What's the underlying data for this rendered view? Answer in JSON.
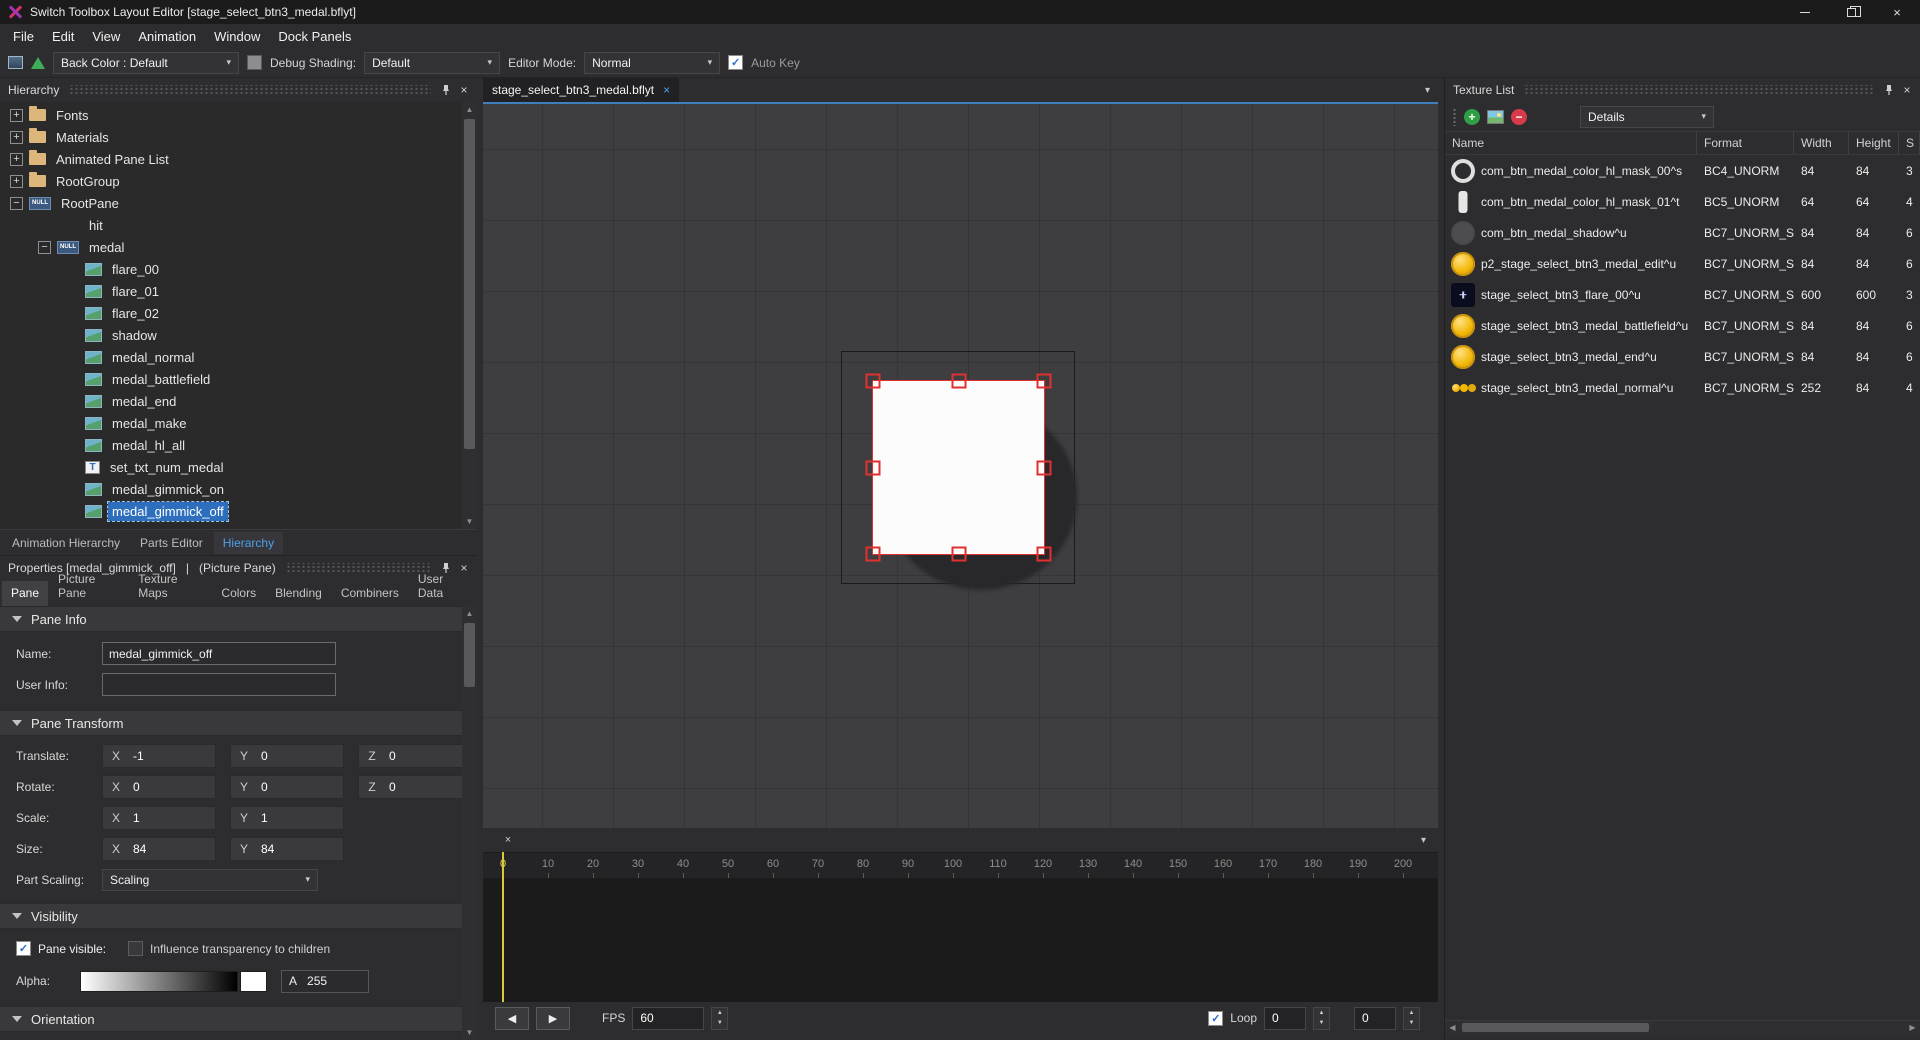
{
  "window": {
    "title": "Switch Toolbox Layout Editor [stage_select_btn3_medal.bflyt]"
  },
  "menu": {
    "items": [
      "File",
      "Edit",
      "View",
      "Animation",
      "Window",
      "Dock Panels"
    ]
  },
  "toolbar": {
    "back_color": "Back Color : Default",
    "debug_shading_label": "Debug Shading:",
    "debug_shading_value": "Default",
    "editor_mode_label": "Editor Mode:",
    "editor_mode_value": "Normal",
    "auto_key": "Auto Key",
    "auto_key_checked": true
  },
  "hierarchy": {
    "title": "Hierarchy",
    "items": [
      {
        "depth": 0,
        "expander": "+",
        "icon": "folder",
        "label": "Fonts"
      },
      {
        "depth": 0,
        "expander": "+",
        "icon": "folder",
        "label": "Materials"
      },
      {
        "depth": 0,
        "expander": "+",
        "icon": "folder",
        "label": "Animated Pane List"
      },
      {
        "depth": 0,
        "expander": "+",
        "icon": "folder",
        "label": "RootGroup"
      },
      {
        "depth": 0,
        "expander": "-",
        "icon": "null",
        "label": "RootPane"
      },
      {
        "depth": 2,
        "expander": "",
        "icon": "",
        "label": "hit"
      },
      {
        "depth": 1,
        "expander": "-",
        "icon": "null",
        "label": "medal"
      },
      {
        "depth": 2,
        "expander": "",
        "icon": "picture",
        "label": "flare_00"
      },
      {
        "depth": 2,
        "expander": "",
        "icon": "picture",
        "label": "flare_01"
      },
      {
        "depth": 2,
        "expander": "",
        "icon": "picture",
        "label": "flare_02"
      },
      {
        "depth": 2,
        "expander": "",
        "icon": "picture",
        "label": "shadow"
      },
      {
        "depth": 2,
        "expander": "",
        "icon": "picture",
        "label": "medal_normal"
      },
      {
        "depth": 2,
        "expander": "",
        "icon": "picture",
        "label": "medal_battlefield"
      },
      {
        "depth": 2,
        "expander": "",
        "icon": "picture",
        "label": "medal_end"
      },
      {
        "depth": 2,
        "expander": "",
        "icon": "picture",
        "label": "medal_make"
      },
      {
        "depth": 2,
        "expander": "",
        "icon": "picture",
        "label": "medal_hl_all"
      },
      {
        "depth": 2,
        "expander": "",
        "icon": "text",
        "label": "set_txt_num_medal"
      },
      {
        "depth": 2,
        "expander": "",
        "icon": "picture",
        "label": "medal_gimmick_on"
      },
      {
        "depth": 2,
        "expander": "",
        "icon": "picture",
        "label": "medal_gimmick_off",
        "selected": true
      }
    ],
    "tabs": [
      {
        "label": "Animation Hierarchy",
        "active": false
      },
      {
        "label": "Parts Editor",
        "active": false
      },
      {
        "label": "Hierarchy",
        "active": true
      }
    ]
  },
  "properties": {
    "title": "Properties [medal_gimmick_off]",
    "separator": "|",
    "subtitle": "(Picture Pane)",
    "tabs": [
      "Pane",
      "Picture Pane",
      "Texture Maps",
      "Colors",
      "Blending",
      "Combiners",
      "User Data"
    ],
    "active_tab": "Pane",
    "pane_info": {
      "section": "Pane Info",
      "name_label": "Name:",
      "name_value": "medal_gimmick_off",
      "user_info_label": "User Info:",
      "user_info_value": ""
    },
    "transform": {
      "section": "Pane Transform",
      "axis": {
        "x": "X",
        "y": "Y",
        "z": "Z"
      },
      "translate_label": "Translate:",
      "translate": {
        "x": "-1",
        "y": "0",
        "z": "0"
      },
      "rotate_label": "Rotate:",
      "rotate": {
        "x": "0",
        "y": "0",
        "z": "0"
      },
      "scale_label": "Scale:",
      "scale": {
        "x": "1",
        "y": "1"
      },
      "size_label": "Size:",
      "size": {
        "x": "84",
        "y": "84"
      },
      "part_scaling_label": "Part Scaling:",
      "part_scaling_value": "Scaling"
    },
    "visibility": {
      "section": "Visibility",
      "pane_visible_label": "Pane visible:",
      "pane_visible_checked": true,
      "influence_label": "Influence transparency to children",
      "influence_checked": false,
      "alpha_label": "Alpha:",
      "alpha_channel_label": "A",
      "alpha_value": "255"
    },
    "orientation": {
      "section": "Orientation"
    }
  },
  "document": {
    "tab": "stage_select_btn3_medal.bflyt",
    "close": "×"
  },
  "timeline": {
    "ticks": [
      0,
      10,
      20,
      30,
      40,
      50,
      60,
      70,
      80,
      90,
      100,
      110,
      120,
      130,
      140,
      150,
      160,
      170,
      180,
      190,
      200
    ],
    "fps_label": "FPS",
    "fps_value": "60",
    "loop_label": "Loop",
    "loop_checked": true,
    "value_a": "0",
    "value_b": "0"
  },
  "texture_list": {
    "title": "Texture List",
    "view_mode": "Details",
    "columns": [
      "Name",
      "Format",
      "Width",
      "Height",
      "S"
    ],
    "rows": [
      {
        "icon": "ring",
        "name": "com_btn_medal_color_hl_mask_00^s",
        "format": "BC4_UNORM",
        "width": "84",
        "height": "84",
        "extra": "3"
      },
      {
        "icon": "bar",
        "name": "com_btn_medal_color_hl_mask_01^t",
        "format": "BC5_UNORM",
        "width": "64",
        "height": "64",
        "extra": "4"
      },
      {
        "icon": "shadow",
        "name": "com_btn_medal_shadow^u",
        "format": "BC7_UNORM_S...",
        "width": "84",
        "height": "84",
        "extra": "6"
      },
      {
        "icon": "coin",
        "name": "p2_stage_select_btn3_medal_edit^u",
        "format": "BC7_UNORM_S...",
        "width": "84",
        "height": "84",
        "extra": "6"
      },
      {
        "icon": "flare",
        "name": "stage_select_btn3_flare_00^u",
        "format": "BC7_UNORM_S...",
        "width": "600",
        "height": "600",
        "extra": "3"
      },
      {
        "icon": "coin",
        "name": "stage_select_btn3_medal_battlefield^u",
        "format": "BC7_UNORM_S...",
        "width": "84",
        "height": "84",
        "extra": "6"
      },
      {
        "icon": "coin",
        "name": "stage_select_btn3_medal_end^u",
        "format": "BC7_UNORM_S...",
        "width": "84",
        "height": "84",
        "extra": "6"
      },
      {
        "icon": "coins3",
        "name": "stage_select_btn3_medal_normal^u",
        "format": "BC7_UNORM_S...",
        "width": "252",
        "height": "84",
        "extra": "4"
      }
    ]
  },
  "colors": {
    "accent_blue": "#3f7fbf",
    "selection_blue": "#2d6fbd",
    "handle_red": "#e03131",
    "playhead_yellow": "#d9c93b",
    "coin_gold": "#f2b705"
  }
}
